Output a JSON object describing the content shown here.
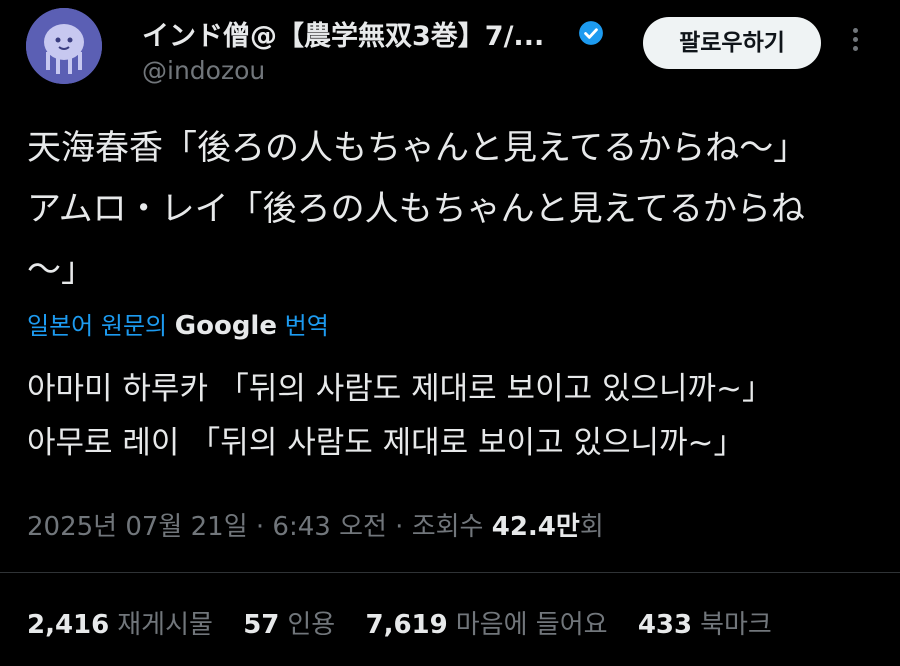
{
  "author": {
    "display_name": "インド僧@【農学無双3巻】7/...",
    "handle": "@indozou",
    "verified_color": "#1d9bf0"
  },
  "follow_label": "팔로우하기",
  "tweet_lines": [
    "天海春香「後ろの人もちゃんと見えてるからね〜」",
    "アムロ・レイ「後ろの人もちゃんと見えてるからね",
    "〜」"
  ],
  "translate": {
    "prefix": "일본어 원문의",
    "brand": "Google",
    "suffix": "번역"
  },
  "translation_lines": [
    "아마미 하루카 「뒤의 사람도 제대로 보이고 있으니까~」",
    "아무로 레이 「뒤의 사람도 제대로 보이고 있으니까~」"
  ],
  "meta": {
    "timestamp": "2025년 07월 21일 · 6:43 오전 · 조회수",
    "views": "42.4만",
    "views_suffix": "회"
  },
  "stats": [
    {
      "count": "2,416",
      "label": "재게시물"
    },
    {
      "count": "57",
      "label": "인용"
    },
    {
      "count": "7,619",
      "label": "마음에 들어요"
    },
    {
      "count": "433",
      "label": "북마크"
    }
  ]
}
